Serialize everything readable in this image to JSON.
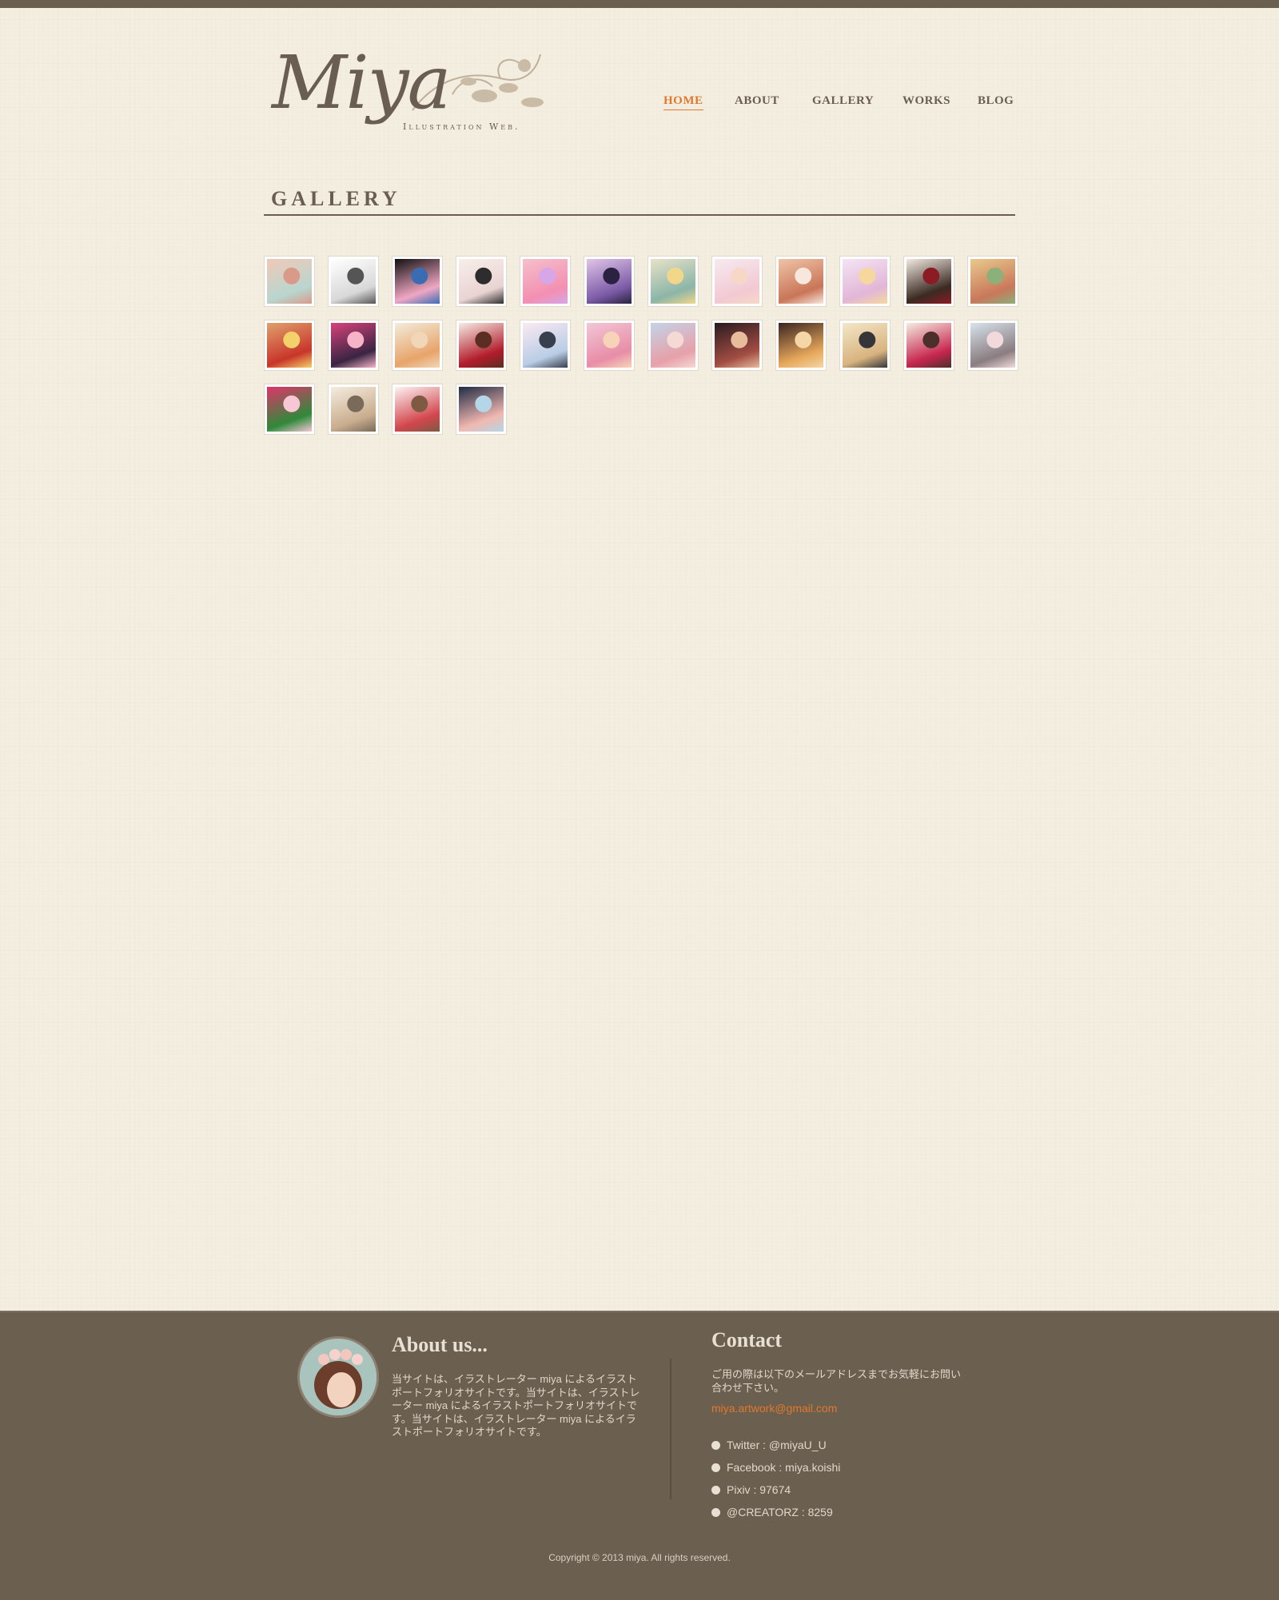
{
  "site": {
    "logo_text": "Miya",
    "logo_subtitle": "Illustration Web."
  },
  "nav": {
    "items": [
      {
        "label": "HOME",
        "active": true
      },
      {
        "label": "ABOUT",
        "active": false
      },
      {
        "label": "GALLERY",
        "active": false
      },
      {
        "label": "WORKS",
        "active": false
      },
      {
        "label": "BLOG",
        "active": false
      }
    ]
  },
  "main": {
    "section_title": "GALLERY",
    "thumbnails": [
      {
        "palette": [
          "#f1c9b8",
          "#b8d6cf",
          "#d99a8a"
        ]
      },
      {
        "palette": [
          "#ffffff",
          "#d8d8d8",
          "#555555"
        ]
      },
      {
        "palette": [
          "#111111",
          "#f1a7c3",
          "#3a6cb3"
        ]
      },
      {
        "palette": [
          "#f7efe9",
          "#e9d3d3",
          "#2d2d2d"
        ]
      },
      {
        "palette": [
          "#f5c0cc",
          "#f48fb1",
          "#d6a6e8"
        ]
      },
      {
        "palette": [
          "#e0c5e8",
          "#7b5aa6",
          "#2a2240"
        ]
      },
      {
        "palette": [
          "#e8e2c8",
          "#8bb5a8",
          "#f2d78a"
        ]
      },
      {
        "palette": [
          "#f7eaf0",
          "#f2c9d3",
          "#f7d8c7"
        ]
      },
      {
        "palette": [
          "#f0c4a8",
          "#c97557",
          "#f7e7dd"
        ]
      },
      {
        "palette": [
          "#f4e4f2",
          "#e2b6d8",
          "#f6d89e"
        ]
      },
      {
        "palette": [
          "#f2e9e1",
          "#3a2a22",
          "#8b1c24"
        ]
      },
      {
        "palette": [
          "#e9c98d",
          "#c9785a",
          "#8bb07a"
        ]
      },
      {
        "palette": [
          "#e0a16d",
          "#c8352a",
          "#f4d26a"
        ]
      },
      {
        "palette": [
          "#d8437c",
          "#3a2442",
          "#f7b4c8"
        ]
      },
      {
        "palette": [
          "#f3ecdc",
          "#e8a46a",
          "#f1d6b7"
        ]
      },
      {
        "palette": [
          "#f6ece4",
          "#b21c2b",
          "#5a2e22"
        ]
      },
      {
        "palette": [
          "#fbe9f1",
          "#b9cde6",
          "#38404e"
        ]
      },
      {
        "palette": [
          "#f2c7d6",
          "#e88da7",
          "#f7d4b8"
        ]
      },
      {
        "palette": [
          "#c3d3e8",
          "#e7a0a8",
          "#f4d9d4"
        ]
      },
      {
        "palette": [
          "#2a1a1f",
          "#a34d43",
          "#e7bb9c"
        ]
      },
      {
        "palette": [
          "#3a2420",
          "#e7a85b",
          "#f5d6a6"
        ]
      },
      {
        "palette": [
          "#f3e7c9",
          "#d9b37f",
          "#35363a"
        ]
      },
      {
        "palette": [
          "#f6ece0",
          "#c6254e",
          "#4b2f29"
        ]
      },
      {
        "palette": [
          "#d8e3ec",
          "#8a7d80",
          "#f2dadc"
        ]
      },
      {
        "palette": [
          "#e0346b",
          "#2f8a3a",
          "#f7c7d6"
        ]
      },
      {
        "palette": [
          "#f5ece0",
          "#c9ad8e",
          "#7a6a5a"
        ]
      },
      {
        "palette": [
          "#fdf3f3",
          "#d2464d",
          "#7e5a43"
        ]
      },
      {
        "palette": [
          "#1f2b44",
          "#f1b8b0",
          "#b4d7e8"
        ]
      }
    ]
  },
  "footer": {
    "about_title": "About us...",
    "about_text": "当サイトは、イラストレーター miya によるイラストポートフォリオサイトです。当サイトは、イラストレーター miya によるイラストポートフォリオサイトです。当サイトは、イラストレーター miya によるイラストポートフォリオサイトです。",
    "contact_title": "Contact",
    "contact_text": "ご用の際は以下のメールアドレスまでお気軽にお問い合わせ下さい。",
    "contact_email": "miya.artwork@gmail.com",
    "social": [
      "Twitter : @miyaU_U",
      "Facebook : miya.koishi",
      "Pixiv : 97674",
      "@CREATORZ : 8259"
    ],
    "copyright": "Copyright © 2013 miya. All rights reserved."
  },
  "colors": {
    "accent": "#e0782c",
    "text": "#6a5e52",
    "footer_bg": "#6b5f50",
    "page_bg": "#f4eee1"
  }
}
